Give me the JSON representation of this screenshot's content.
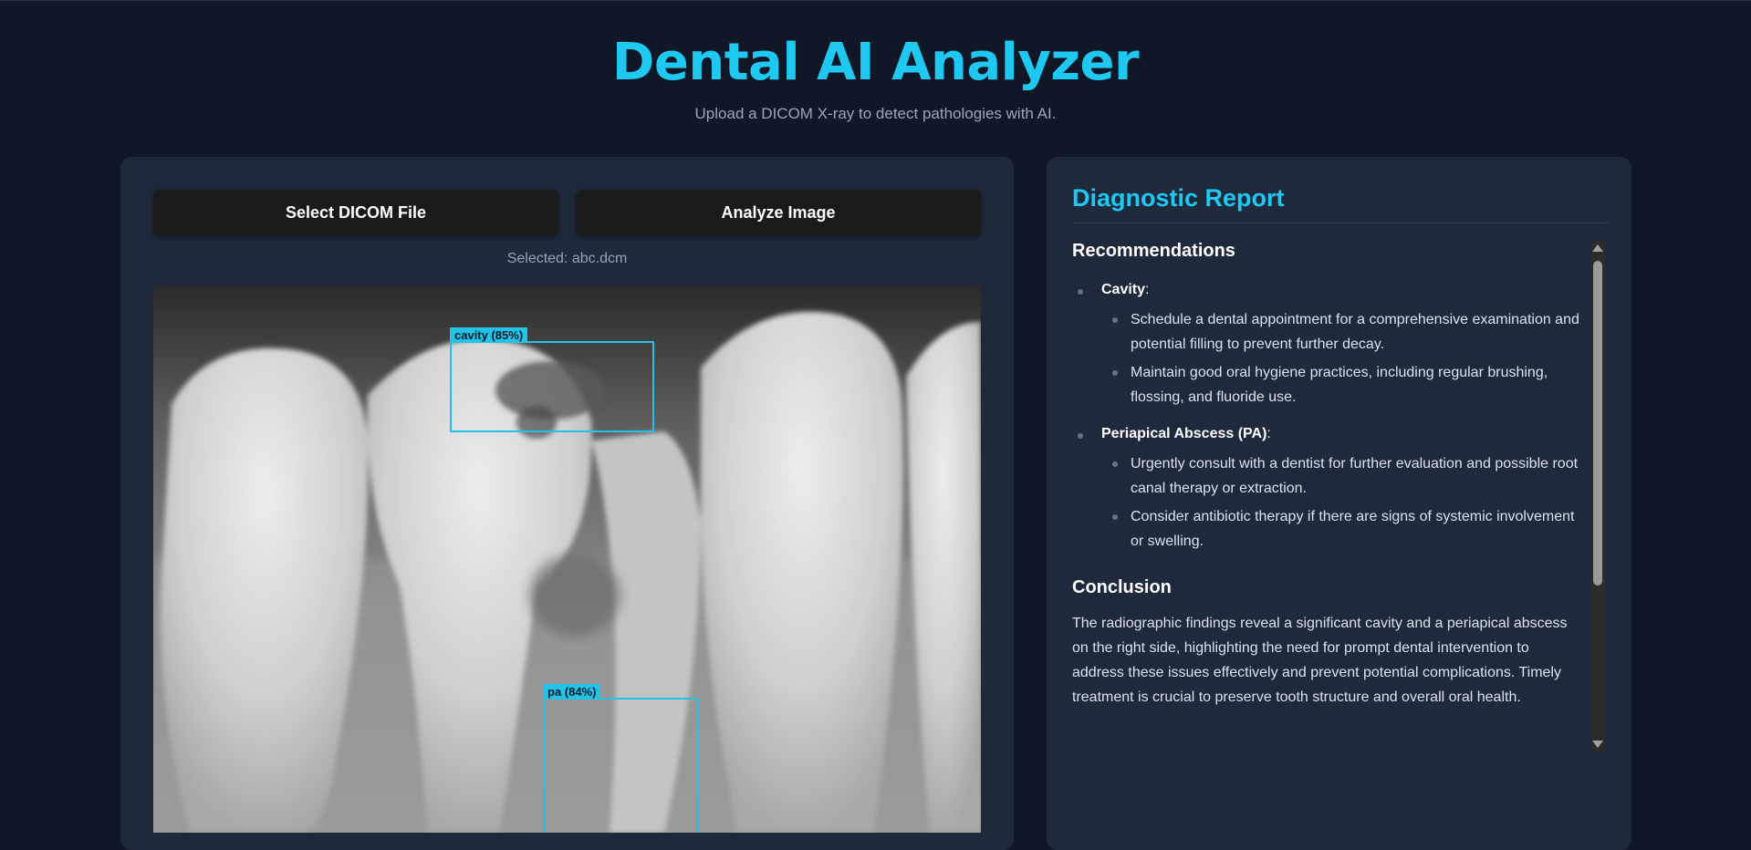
{
  "header": {
    "title": "Dental AI Analyzer",
    "subtitle": "Upload a DICOM X-ray to detect pathologies with AI."
  },
  "controls": {
    "select_label": "Select DICOM File",
    "analyze_label": "Analyze Image",
    "selected_text": "Selected: abc.dcm"
  },
  "detections": [
    {
      "label": "cavity (85%)"
    },
    {
      "label": "pa (84%)"
    }
  ],
  "report": {
    "title": "Diagnostic Report",
    "recommendations_heading": "Recommendations",
    "recommendations": [
      {
        "category": "Cavity",
        "items": [
          "Schedule a dental appointment for a comprehensive examination and potential filling to prevent further decay.",
          "Maintain good oral hygiene practices, including regular brushing, flossing, and fluoride use."
        ]
      },
      {
        "category": "Periapical Abscess (PA)",
        "items": [
          "Urgently consult with a dentist for further evaluation and possible root canal therapy or extraction.",
          "Consider antibiotic therapy if there are signs of systemic involvement or swelling."
        ]
      }
    ],
    "conclusion_heading": "Conclusion",
    "conclusion": "The radiographic findings reveal a significant cavity and a periapical abscess on the right side, highlighting the need for prompt dental intervention to address these issues effectively and prevent potential complications. Timely treatment is crucial to preserve tooth structure and overall oral health."
  },
  "colors": {
    "background": "#101828",
    "panel": "#1e293b",
    "accent": "#1ec8f0",
    "detection_box": "#22c3e6",
    "button": "#1a1a1a"
  },
  "icons": {
    "scroll_up": "triangle-up-icon",
    "scroll_down": "triangle-down-icon"
  }
}
